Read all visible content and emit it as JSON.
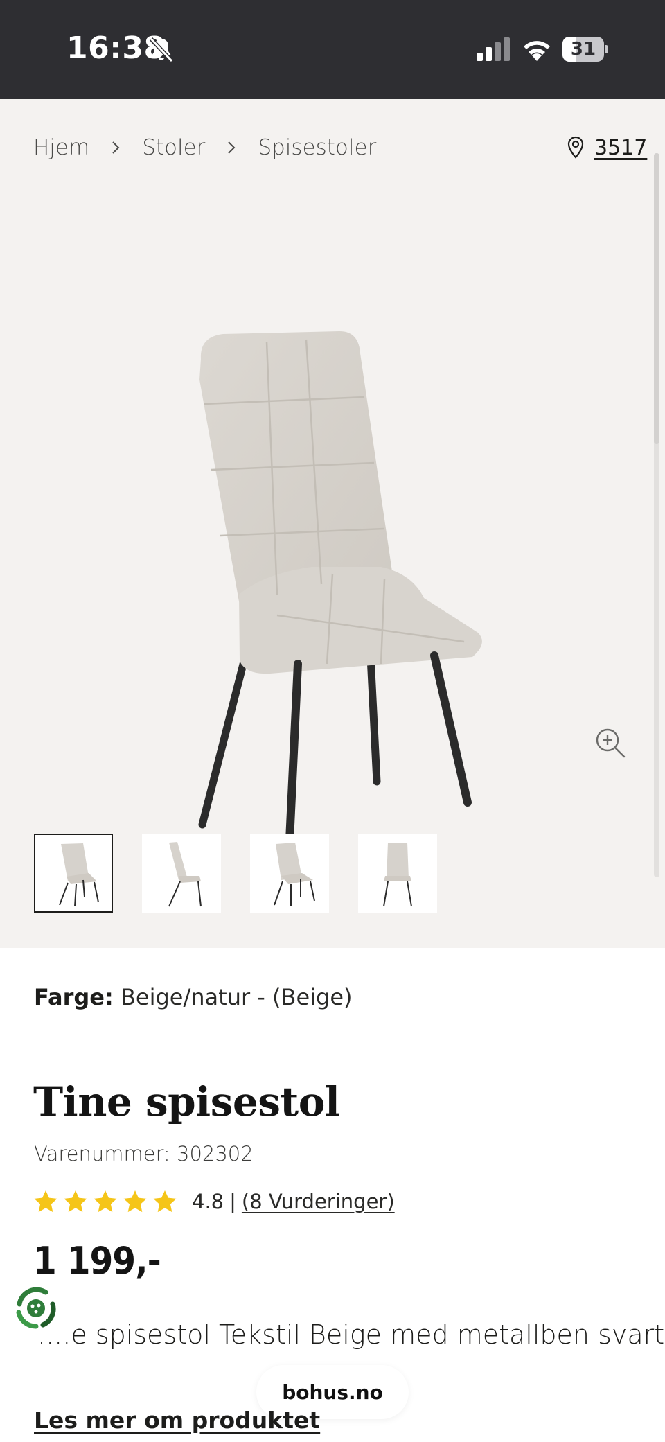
{
  "status_bar": {
    "time": "16:38",
    "battery_level": "31",
    "battery_fraction": 0.31
  },
  "breadcrumb": {
    "items": [
      "Hjem",
      "Stoler",
      "Spisestoler"
    ],
    "store_number": "3517"
  },
  "gallery": {
    "thumbnail_count": 4,
    "active_thumbnail": 0
  },
  "product": {
    "color_label": "Farge:",
    "color_value": "Beige/natur - (Beige)",
    "title": "Tine spisestol",
    "sku": "Varenummer: 302302",
    "rating_value": "4.8",
    "rating_separator": "|",
    "rating_count": "(8 Vurderinger)",
    "stars": 5,
    "price": "1 199,-",
    "description": "....e spisestol Tekstil Beige med metallben svart",
    "read_more": "Les mer om produktet"
  },
  "browser": {
    "url": "bohus.no"
  },
  "colors": {
    "status_bar_bg": "#2e2e32",
    "gallery_bg": "#f4f2f0",
    "star": "#f5c518",
    "text": "#1d1d1b",
    "badge_green": "#2f7d3a"
  }
}
